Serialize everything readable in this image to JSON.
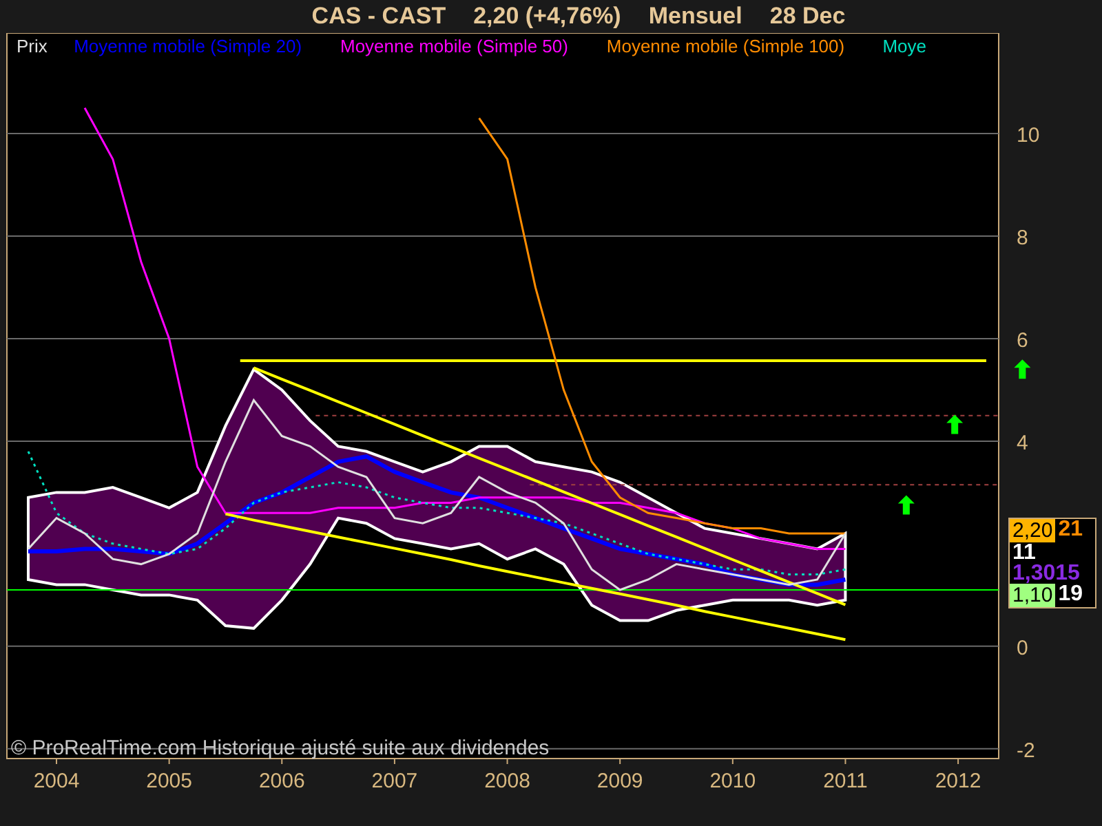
{
  "title": {
    "symbol": "CAS - CAST",
    "price": "2,20 (+4,76%)",
    "period": "Mensuel",
    "date": "28 Dec"
  },
  "chart_data": {
    "type": "line",
    "x": [
      2003.75,
      2004,
      2004.25,
      2004.5,
      2004.75,
      2005,
      2005.25,
      2005.5,
      2005.75,
      2006,
      2006.25,
      2006.5,
      2006.75,
      2007,
      2007.25,
      2007.5,
      2007.75,
      2008,
      2008.25,
      2008.5,
      2008.75,
      2009,
      2009.25,
      2009.5,
      2009.75,
      2010,
      2010.25,
      2010.5,
      2010.75,
      2011
    ],
    "series": [
      {
        "name": "Prix",
        "color": "#e0e0e0",
        "values": [
          1.9,
          2.5,
          2.2,
          1.7,
          1.6,
          1.8,
          2.2,
          3.6,
          4.8,
          4.1,
          3.9,
          3.5,
          3.3,
          2.5,
          2.4,
          2.6,
          3.3,
          3.0,
          2.8,
          2.4,
          1.5,
          1.1,
          1.3,
          1.6,
          1.5,
          1.4,
          1.3,
          1.2,
          1.3,
          2.2
        ]
      },
      {
        "name": "Moyenne mobile (Simple 20)",
        "color": "#0000ff",
        "values": [
          1.85,
          1.85,
          1.9,
          1.9,
          1.85,
          1.8,
          2.0,
          2.4,
          2.8,
          3.0,
          3.3,
          3.6,
          3.7,
          3.4,
          3.2,
          3.0,
          2.9,
          2.7,
          2.5,
          2.3,
          2.1,
          1.9,
          1.8,
          1.7,
          1.6,
          1.4,
          1.3,
          1.2,
          1.2,
          1.3
        ]
      },
      {
        "name": "Moyenne mobile (Simple 50)",
        "color": "#ff00ff",
        "values": [
          null,
          null,
          10.5,
          9.5,
          7.5,
          6.0,
          3.5,
          2.6,
          2.6,
          2.6,
          2.6,
          2.7,
          2.7,
          2.7,
          2.8,
          2.8,
          2.9,
          2.9,
          2.9,
          2.9,
          2.8,
          2.8,
          2.7,
          2.6,
          2.4,
          2.3,
          2.1,
          2.0,
          1.9,
          1.9
        ]
      },
      {
        "name": "Moyenne mobile (Simple 100)",
        "color": "#ff8c00",
        "values": [
          null,
          null,
          null,
          null,
          null,
          null,
          null,
          null,
          null,
          null,
          null,
          null,
          null,
          null,
          null,
          null,
          10.3,
          9.5,
          7.0,
          5.0,
          3.6,
          2.9,
          2.6,
          2.5,
          2.4,
          2.3,
          2.3,
          2.2,
          2.2,
          2.2
        ]
      },
      {
        "name": "Moye",
        "color": "#00e0c0",
        "line_style": "dotted",
        "values": [
          3.8,
          2.6,
          2.2,
          2.0,
          1.9,
          1.8,
          1.9,
          2.3,
          2.8,
          3.0,
          3.1,
          3.2,
          3.1,
          2.9,
          2.8,
          2.7,
          2.7,
          2.6,
          2.5,
          2.4,
          2.2,
          2.0,
          1.8,
          1.7,
          1.6,
          1.5,
          1.5,
          1.4,
          1.4,
          1.5
        ]
      },
      {
        "color": "#ffff00",
        "values": [
          null,
          null,
          null,
          null,
          null,
          null,
          null,
          null,
          5.43,
          5.21,
          4.99,
          4.77,
          4.55,
          4.33,
          4.11,
          3.89,
          3.67,
          3.45,
          3.23,
          3.01,
          2.79,
          2.57,
          2.35,
          2.13,
          1.91,
          1.69,
          1.47,
          1.25,
          1.03,
          0.81
        ]
      },
      {
        "color": "#ffff00",
        "values": [
          null,
          null,
          null,
          null,
          null,
          null,
          null,
          2.58,
          2.46,
          2.35,
          2.24,
          2.13,
          2.02,
          1.91,
          1.8,
          1.69,
          1.57,
          1.46,
          1.35,
          1.24,
          1.13,
          1.02,
          0.91,
          0.8,
          0.68,
          0.57,
          0.46,
          0.35,
          0.24,
          0.13
        ]
      }
    ],
    "xlim": [
      2003.56,
      2012.36
    ],
    "ylim": [
      -2.19,
      11.96
    ],
    "xticks": [
      2004,
      2005,
      2006,
      2007,
      2008,
      2009,
      2010,
      2011,
      2012
    ],
    "yticks": [
      -2,
      0,
      4,
      6,
      8,
      10
    ],
    "grid": true,
    "ref_lines": [
      {
        "axis": "y",
        "value": 1.1,
        "color": "#00ff00"
      },
      {
        "axis": "y",
        "value": 4.5,
        "color": "#a04040"
      },
      {
        "axis": "y",
        "value": 3.15,
        "color": "#a04040"
      },
      {
        "axis": "y",
        "value": 5.57,
        "color": "#ffff00"
      }
    ]
  },
  "price_labels": [
    {
      "text": "2,20",
      "kind": "badge",
      "color": "#ffb400"
    },
    {
      "text": "21",
      "kind": "text",
      "color": "#ff8c00"
    },
    {
      "text": "11",
      "kind": "text",
      "color": "#ffffff"
    },
    {
      "text": "1,3015",
      "kind": "text",
      "color": "#8a2be2"
    },
    {
      "text": "1,10",
      "kind": "badge",
      "color": "#a0ff80"
    },
    {
      "text": "19",
      "kind": "text",
      "color": "#ffffff"
    }
  ],
  "footer": "© ProRealTime.com Historique ajusté suite aux dividendes"
}
